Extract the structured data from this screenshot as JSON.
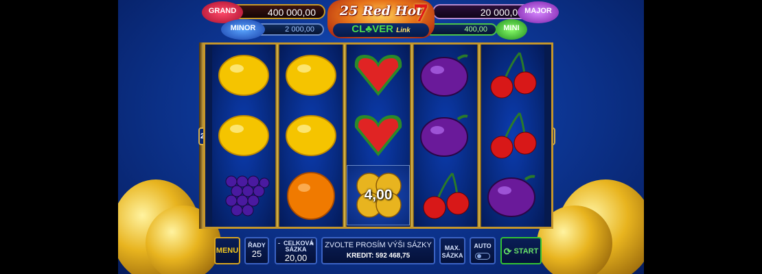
{
  "jackpots": {
    "grand": {
      "label": "GRAND",
      "value": "400 000,00"
    },
    "major": {
      "label": "MAJOR",
      "value": "20 000,00"
    },
    "minor": {
      "label": "MINOR",
      "value": "2 000,00"
    },
    "mini": {
      "label": "MINI",
      "value": "400,00"
    }
  },
  "logo": {
    "top": "25 Red Hot",
    "seven": "7",
    "clover": "CL♣VER",
    "link": "Link"
  },
  "paylines": "25",
  "reels": [
    [
      "lemon",
      "lemon",
      "grapes"
    ],
    [
      "lemon",
      "lemon",
      "orange"
    ],
    [
      "watermelon",
      "watermelon",
      "clover-bonus"
    ],
    [
      "plum",
      "plum",
      "cherry"
    ],
    [
      "cherry",
      "cherry",
      "plum"
    ]
  ],
  "bonus_value": "4,00",
  "controls": {
    "menu": "MENU",
    "lines_label": "ŘADY",
    "lines_value": "25",
    "bet_minus": "-",
    "bet_label": "CELKOVÁ SÁZKA",
    "bet_plus": "+",
    "bet_value": "20,00",
    "message": "ZVOLTE PROSÍM VÝŠI SÁZKY",
    "credit_label": "KREDIT:",
    "credit_value": "592 468,75",
    "max_bet": "MAX. SÁZKA",
    "auto": "AUTO",
    "start": "START"
  }
}
